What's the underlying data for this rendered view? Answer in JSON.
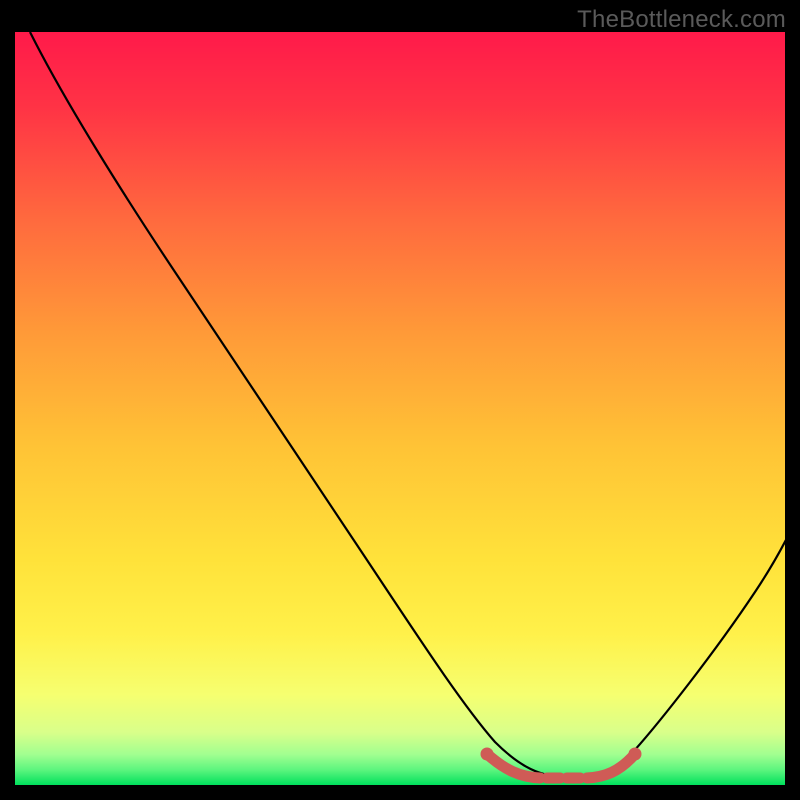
{
  "watermark": "TheBottleneck.com",
  "chart_data": {
    "type": "line",
    "title": "",
    "xlabel": "",
    "ylabel": "",
    "xlim": [
      0,
      100
    ],
    "ylim": [
      0,
      100
    ],
    "background_gradient": {
      "top_color": "#ff1744",
      "mid_color": "#ffd740",
      "low_color": "#fff59d",
      "bottom_color": "#00e676",
      "description": "vertical gradient red→orange→yellow→green representing fit quality (red=bad, green=good)"
    },
    "series": [
      {
        "name": "bottleneck-curve",
        "color": "#000000",
        "x": [
          2,
          10,
          20,
          30,
          40,
          50,
          56,
          60,
          64,
          68,
          72,
          76,
          80,
          86,
          92,
          100
        ],
        "values": [
          100,
          87,
          72,
          57,
          42,
          27,
          18,
          12,
          6,
          2,
          0,
          0,
          2,
          12,
          27,
          50
        ]
      },
      {
        "name": "optimal-range-marker",
        "color": "#d9534f",
        "x": [
          60,
          64,
          68,
          72,
          76,
          80
        ],
        "values": [
          2.5,
          1.5,
          1.5,
          1.5,
          1.5,
          2.5
        ],
        "style": "thick-dotted"
      }
    ],
    "optimal_range_x": [
      60,
      80
    ],
    "grid": false,
    "legend": false
  }
}
